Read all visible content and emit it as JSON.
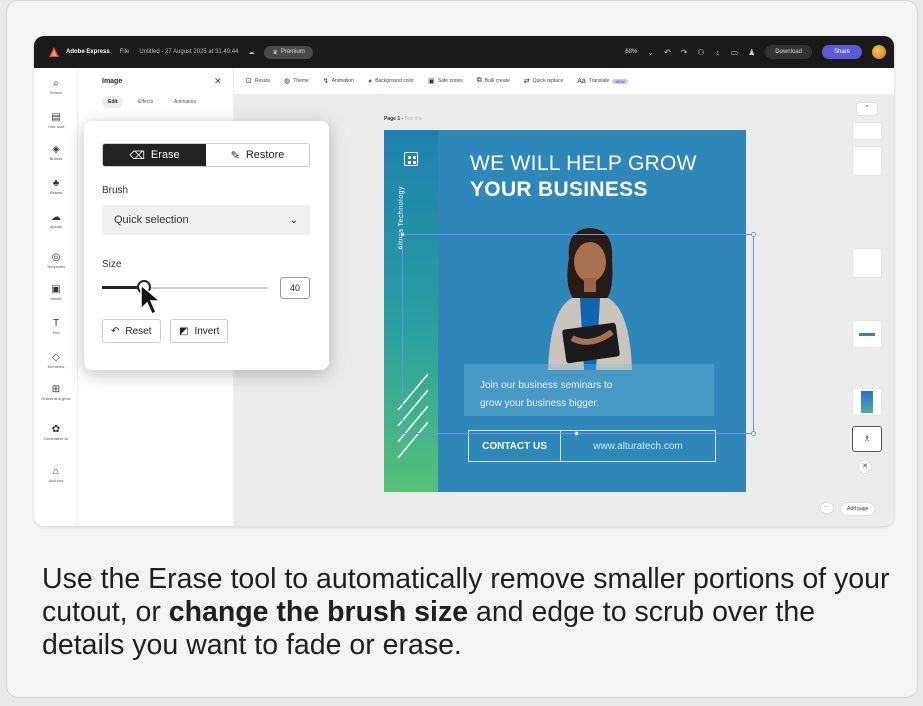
{
  "topbar": {
    "app_name": "Adobe Express",
    "file_menu": "File",
    "doc_title": "Untitled - 27 August 2025 at 31.49.44",
    "premium_label": "Premium",
    "zoom": "68%",
    "download_label": "Download",
    "share_label": "Share"
  },
  "rail": {
    "items": [
      {
        "label": "Search",
        "icon": "search-icon"
      },
      {
        "label": "Your stuff",
        "icon": "folder-icon"
      },
      {
        "label": "Brands",
        "icon": "brand-icon"
      },
      {
        "label": "Assets",
        "icon": "assets-icon"
      },
      {
        "label": "Upload",
        "icon": "upload-icon"
      },
      {
        "label": "Templates",
        "icon": "templates-icon"
      },
      {
        "label": "Media",
        "icon": "media-icon"
      },
      {
        "label": "Text",
        "icon": "text-icon"
      },
      {
        "label": "Elements",
        "icon": "elements-icon"
      },
      {
        "label": "Charts and grids",
        "icon": "charts-icon"
      },
      {
        "label": "Generative AI",
        "icon": "ai-icon"
      },
      {
        "label": "Add-ons",
        "icon": "addons-icon"
      }
    ]
  },
  "panel": {
    "title": "Image",
    "tabs": [
      "Edit",
      "Effects",
      "Animation"
    ]
  },
  "canvas_toolbar": {
    "items": [
      "Resize",
      "Theme",
      "Animation",
      "Background color",
      "Safe zones",
      "Bulk create",
      "Quick replace",
      "Translate"
    ],
    "new_badge": "NEW"
  },
  "canvas": {
    "page_label": "Page 1",
    "page_sub": "Add title"
  },
  "design": {
    "side_text": "Altura Technology",
    "headline_1": "WE WILL HELP GROW",
    "headline_2": "YOUR BUSINESS",
    "sub_1": "Join our business seminars to",
    "sub_2": "grow your business bigger.",
    "cta_label": "CONTACT US",
    "cta_url": "www.alturatech.com"
  },
  "popup": {
    "erase_label": "Erase",
    "restore_label": "Restore",
    "brush_label": "Brush",
    "brush_value": "Quick selection",
    "size_label": "Size",
    "size_value": "40",
    "size_fraction": 0.25,
    "reset_label": "Reset",
    "invert_label": "Invert"
  },
  "right_rail": {
    "add_page_label": "Add page"
  },
  "caption": {
    "part1": "Use the Erase tool to automatically remove smaller portions of your cutout, or ",
    "bold": "change the brush size",
    "part2": " and edge to scrub over the details you want to fade or erase."
  }
}
